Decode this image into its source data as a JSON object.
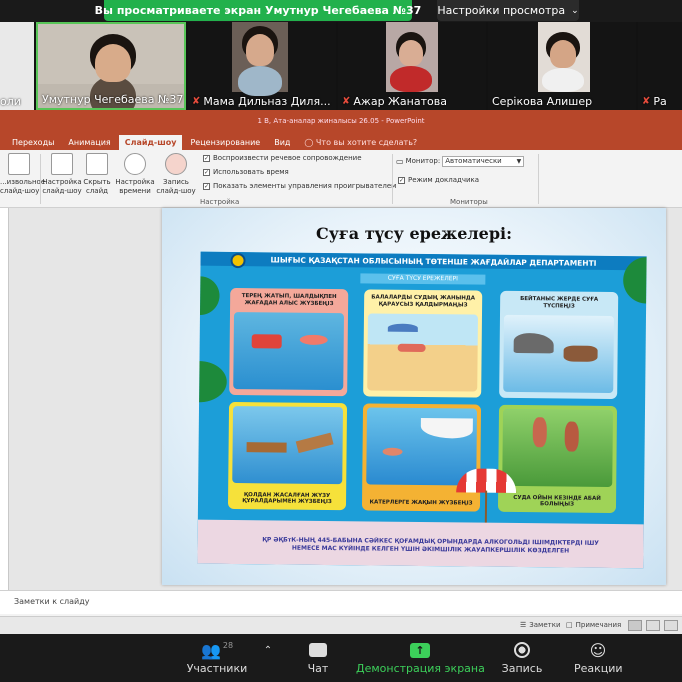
{
  "share": {
    "banner": "Вы просматриваете экран Умутнур Чегебаева №37",
    "view_settings": "Настройки просмотра"
  },
  "participants": [
    {
      "name": "оли",
      "muted": false
    },
    {
      "name": "Умутнур Чегебаева №37",
      "muted": false
    },
    {
      "name": "Мама Дильназ Диля...",
      "muted": true
    },
    {
      "name": "Ажар Жанатова",
      "muted": true
    },
    {
      "name": "Серікова Алишер",
      "muted": false
    },
    {
      "name": "Ра",
      "muted": true
    }
  ],
  "powerpoint": {
    "title": "1 В, Ата-аналар жиналысы 26.05 - PowerPoint",
    "tabs": [
      "Переходы",
      "Анимация",
      "Слайд-шоу",
      "Рецензирование",
      "Вид"
    ],
    "active_tab": "Слайд-шоу",
    "search": "Что вы хотите сделать?",
    "ribbon": {
      "btn_custom": "...извольное\nслайд-шоу",
      "btn_setup": "Настройка\nслайд-шоу",
      "btn_hide": "Скрыть\nслайд",
      "btn_timing": "Настройка\nвремени",
      "btn_record": "Запись\nслайд-шоу",
      "check_narration": "Воспроизвести речевое сопровождение",
      "check_timings": "Использовать время",
      "check_controls": "Показать элементы управления проигрывателем",
      "group_setup": "Настройка",
      "monitor_label": "Монитор:",
      "monitor_value": "Автоматически",
      "check_presenter": "Режим докладчика",
      "group_monitors": "Мониторы"
    },
    "slide_title": "Суға түсу ережелері:",
    "poster": {
      "header": "ШЫҒЫС ҚАЗАҚСТАН ОБЛЫСЫНЫҢ ТӨТЕНШЕ ЖАҒДАЙЛАР ДЕПАРТАМЕНТІ",
      "subtitle": "СУҒА ТҮСУ ЕРЕЖЕЛЕРІ",
      "panels": [
        "ТЕРЕҢ ЖАТЫП, ШАЛДЫҚПЕН ЖАҒАДАН АЛЫС ЖҮЗБЕҢІЗ",
        "БАЛАЛАРДЫ СУДЫҢ ЖАНЫНДА ҚАРАУСЫЗ ҚАЛДЫРМАҢЫЗ",
        "БЕЙТАНЫС ЖЕРДЕ СУҒА ТҮСПЕҢІЗ",
        "ҚОЛДАН ЖАСАЛҒАН ЖҮЗУ ҚҰРАЛДАРЫМЕН ЖҮЗБЕҢІЗ",
        "КАТЕРЛЕРГЕ ЖАҚЫН ЖҮЗБЕҢІЗ",
        "СУДА ОЙЫН КЕЗІНДЕ АБАЙ БОЛЫҢЫЗ"
      ],
      "footer": "ҚР ӘҚБтК-НЫҢ 445-БАБЫНА СӘЙКЕС ҚОҒАМДЫҚ ОРЫНДАРДА АЛКОГОЛЬДІ ІШІМДІКТЕРДІ ІШУ НЕМЕСЕ МАС КҮЙІНДЕ КЕЛГЕН ҮШІН ӘКІМШІЛІК ЖАУАПКЕРШІЛІК КӨЗДЕЛГЕН"
    },
    "notes": "Заметки к слайду",
    "status_notes": "Заметки",
    "status_comments": "Примечания"
  },
  "toolbar": {
    "participants_label": "Участники",
    "participants_count": "28",
    "chat_label": "Чат",
    "share_label": "Демонстрация экрана",
    "record_label": "Запись",
    "reactions_label": "Реакции"
  },
  "colors": {
    "share_green": "#22b14c",
    "ppt_accent": "#b7472a",
    "muted_red": "#e74c3c"
  }
}
